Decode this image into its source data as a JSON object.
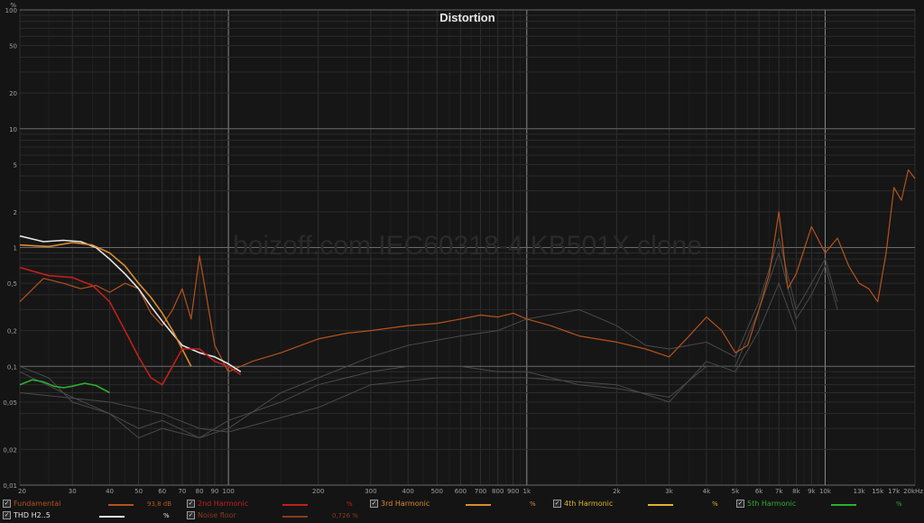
{
  "chart_data": {
    "type": "line",
    "title": "Distortion",
    "watermark": "boizoff.com IEC60318-4 KB501X clone",
    "y_unit_label": "%",
    "x_scale": "log",
    "y_scale": "log",
    "xlim": [
      20,
      20000
    ],
    "ylim": [
      0.01,
      100
    ],
    "grid": true,
    "x_ticks": [
      {
        "v": 20,
        "label": "20"
      },
      {
        "v": 30,
        "label": "30"
      },
      {
        "v": 40,
        "label": "40"
      },
      {
        "v": 50,
        "label": "50"
      },
      {
        "v": 60,
        "label": "60"
      },
      {
        "v": 70,
        "label": "70"
      },
      {
        "v": 80,
        "label": "80"
      },
      {
        "v": 90,
        "label": "90"
      },
      {
        "v": 100,
        "label": "100"
      },
      {
        "v": 200,
        "label": "200"
      },
      {
        "v": 300,
        "label": "300"
      },
      {
        "v": 400,
        "label": "400"
      },
      {
        "v": 500,
        "label": "500"
      },
      {
        "v": 600,
        "label": "600"
      },
      {
        "v": 700,
        "label": "700"
      },
      {
        "v": 800,
        "label": "800"
      },
      {
        "v": 900,
        "label": "900"
      },
      {
        "v": 1000,
        "label": "1k"
      },
      {
        "v": 2000,
        "label": "2k"
      },
      {
        "v": 3000,
        "label": "3k"
      },
      {
        "v": 4000,
        "label": "4k"
      },
      {
        "v": 5000,
        "label": "5k"
      },
      {
        "v": 6000,
        "label": "6k"
      },
      {
        "v": 7000,
        "label": "7k"
      },
      {
        "v": 8000,
        "label": "8k"
      },
      {
        "v": 9000,
        "label": "9k"
      },
      {
        "v": 10000,
        "label": "10k"
      },
      {
        "v": 13000,
        "label": "13k"
      },
      {
        "v": 15000,
        "label": "15k"
      },
      {
        "v": 17000,
        "label": "17k"
      },
      {
        "v": 20000,
        "label": "20kHz"
      }
    ],
    "y_ticks": [
      {
        "v": 100,
        "label": "100"
      },
      {
        "v": 50,
        "label": "50"
      },
      {
        "v": 20,
        "label": "20"
      },
      {
        "v": 10,
        "label": "10"
      },
      {
        "v": 5,
        "label": "5"
      },
      {
        "v": 2,
        "label": "2"
      },
      {
        "v": 1,
        "label": "1"
      },
      {
        "v": 0.5,
        "label": "0,5"
      },
      {
        "v": 0.2,
        "label": "0,2"
      },
      {
        "v": 0.1,
        "label": "0,1"
      },
      {
        "v": 0.05,
        "label": "0,05"
      },
      {
        "v": 0.02,
        "label": "0,02"
      },
      {
        "v": 0.01,
        "label": "0,01"
      }
    ],
    "series": [
      {
        "name": "Fundamental",
        "color": "#b5521c",
        "reading": "93,8 dB",
        "x": [
          20,
          24,
          28,
          32,
          36,
          40,
          45,
          50,
          55,
          60,
          65,
          70,
          75,
          80,
          85,
          90,
          100,
          120,
          150,
          200,
          250,
          300,
          400,
          500,
          600,
          700,
          800,
          900,
          1000,
          1200,
          1500,
          2000,
          2500,
          3000,
          3500,
          4000,
          4500,
          5000,
          5500,
          6000,
          6500,
          7000,
          7500,
          8000,
          9000,
          10000,
          11000,
          12000,
          13000,
          14000,
          15000,
          16000,
          17000,
          18000,
          19000,
          20000
        ],
        "y": [
          0.35,
          0.55,
          0.5,
          0.45,
          0.48,
          0.42,
          0.5,
          0.45,
          0.28,
          0.22,
          0.3,
          0.45,
          0.25,
          0.85,
          0.35,
          0.15,
          0.09,
          0.11,
          0.13,
          0.17,
          0.19,
          0.2,
          0.22,
          0.23,
          0.25,
          0.27,
          0.26,
          0.28,
          0.25,
          0.22,
          0.18,
          0.16,
          0.14,
          0.12,
          0.18,
          0.26,
          0.2,
          0.13,
          0.15,
          0.3,
          0.6,
          2.0,
          0.45,
          0.6,
          1.5,
          0.9,
          1.2,
          0.7,
          0.5,
          0.45,
          0.35,
          0.9,
          3.2,
          2.5,
          4.5,
          3.8
        ]
      },
      {
        "name": "2nd Harmonic",
        "color": "#c0201a",
        "reading": "",
        "x": [
          20,
          25,
          30,
          35,
          40,
          45,
          50,
          55,
          60,
          70,
          80,
          90,
          100,
          110
        ],
        "y": [
          0.68,
          0.58,
          0.56,
          0.48,
          0.35,
          0.2,
          0.12,
          0.08,
          0.07,
          0.14,
          0.14,
          0.11,
          0.1,
          0.085
        ]
      },
      {
        "name": "3rd Harmonic",
        "color": "#d98c2e",
        "reading": "",
        "x": [
          20,
          25,
          30,
          35,
          40,
          45,
          50,
          55,
          60,
          65,
          70,
          75
        ],
        "y": [
          1.05,
          1.02,
          1.1,
          1.05,
          0.9,
          0.7,
          0.5,
          0.38,
          0.28,
          0.2,
          0.14,
          0.1
        ]
      },
      {
        "name": "4th Harmonic",
        "color": "#e0b52a",
        "reading": "",
        "x": [],
        "y": []
      },
      {
        "name": "5th Harmonic",
        "color": "#2fae2f",
        "reading": "",
        "x": [
          20,
          22,
          24,
          26,
          28,
          30,
          33,
          36,
          40
        ],
        "y": [
          0.07,
          0.077,
          0.074,
          0.068,
          0.066,
          0.068,
          0.072,
          0.069,
          0.06
        ]
      },
      {
        "name": "THD H2..5",
        "color": "#e6e6e6",
        "reading": "",
        "x": [
          20,
          24,
          28,
          32,
          36,
          40,
          45,
          50,
          55,
          60,
          70,
          80,
          90,
          100,
          110
        ],
        "y": [
          1.25,
          1.12,
          1.15,
          1.12,
          1.0,
          0.8,
          0.6,
          0.45,
          0.32,
          0.24,
          0.15,
          0.13,
          0.12,
          0.105,
          0.09
        ]
      },
      {
        "name": "Noise floor",
        "color": "#8a3a20",
        "reading": "0,726 %",
        "x": [],
        "y": []
      }
    ],
    "grey_series": [
      {
        "x": [
          20,
          25,
          30,
          40,
          50,
          60,
          80,
          100,
          150,
          200,
          300,
          400,
          600,
          800,
          1000,
          1500,
          2000,
          2500,
          3000,
          4000,
          5000,
          6000,
          7000,
          8000,
          9000,
          10000,
          11000
        ],
        "y": [
          0.1,
          0.08,
          0.05,
          0.04,
          0.025,
          0.03,
          0.025,
          0.03,
          0.06,
          0.08,
          0.12,
          0.15,
          0.18,
          0.2,
          0.25,
          0.3,
          0.22,
          0.15,
          0.14,
          0.16,
          0.12,
          0.35,
          1.2,
          0.3,
          0.5,
          0.8,
          0.35
        ]
      },
      {
        "x": [
          20,
          30,
          40,
          50,
          60,
          80,
          100,
          150,
          200,
          300,
          400,
          600,
          800,
          1000,
          1500,
          2000,
          3000,
          4000,
          5000,
          6000,
          7000,
          8000,
          9000,
          10000,
          11000
        ],
        "y": [
          0.09,
          0.055,
          0.04,
          0.03,
          0.035,
          0.025,
          0.035,
          0.05,
          0.07,
          0.09,
          0.1,
          0.1,
          0.09,
          0.09,
          0.07,
          0.065,
          0.055,
          0.1,
          0.1,
          0.3,
          0.9,
          0.25,
          0.4,
          0.7,
          0.3
        ]
      },
      {
        "x": [
          20,
          40,
          60,
          80,
          100,
          200,
          300,
          500,
          1000,
          2000,
          3000,
          4000,
          5000,
          6000,
          7000,
          8000
        ],
        "y": [
          0.06,
          0.05,
          0.04,
          0.03,
          0.028,
          0.045,
          0.07,
          0.08,
          0.08,
          0.07,
          0.05,
          0.11,
          0.09,
          0.2,
          0.5,
          0.2
        ]
      }
    ]
  },
  "legend": {
    "rows": [
      [
        {
          "name": "Fundamental",
          "value": "93,8 dB",
          "unit": "",
          "color": "#b5521c",
          "label_color": "#b5521c",
          "checked": "✓"
        },
        {
          "name": "2nd Harmonic",
          "value": "",
          "unit": "%",
          "color": "#c0201a",
          "label_color": "#c0201a",
          "checked": "✓"
        },
        {
          "name": "3rd Harmonic",
          "value": "",
          "unit": "%",
          "color": "#d98c2e",
          "label_color": "#d98c2e",
          "checked": "✓"
        },
        {
          "name": "4th Harmonic",
          "value": "",
          "unit": "%",
          "color": "#e0b52a",
          "label_color": "#e0b52a",
          "checked": "✓"
        },
        {
          "name": "5th Harmonic",
          "value": "",
          "unit": "%",
          "color": "#2fae2f",
          "label_color": "#2fae2f",
          "checked": "✓"
        }
      ],
      [
        {
          "name": "THD H2..5",
          "value": "",
          "unit": "%",
          "color": "#e6e6e6",
          "label_color": "#e6e6e6",
          "checked": "✓"
        },
        {
          "name": "Noise floor",
          "value": "0,726 %",
          "unit": "",
          "color": "#8a3a20",
          "label_color": "#8a3a20",
          "checked": "✓"
        }
      ]
    ]
  }
}
